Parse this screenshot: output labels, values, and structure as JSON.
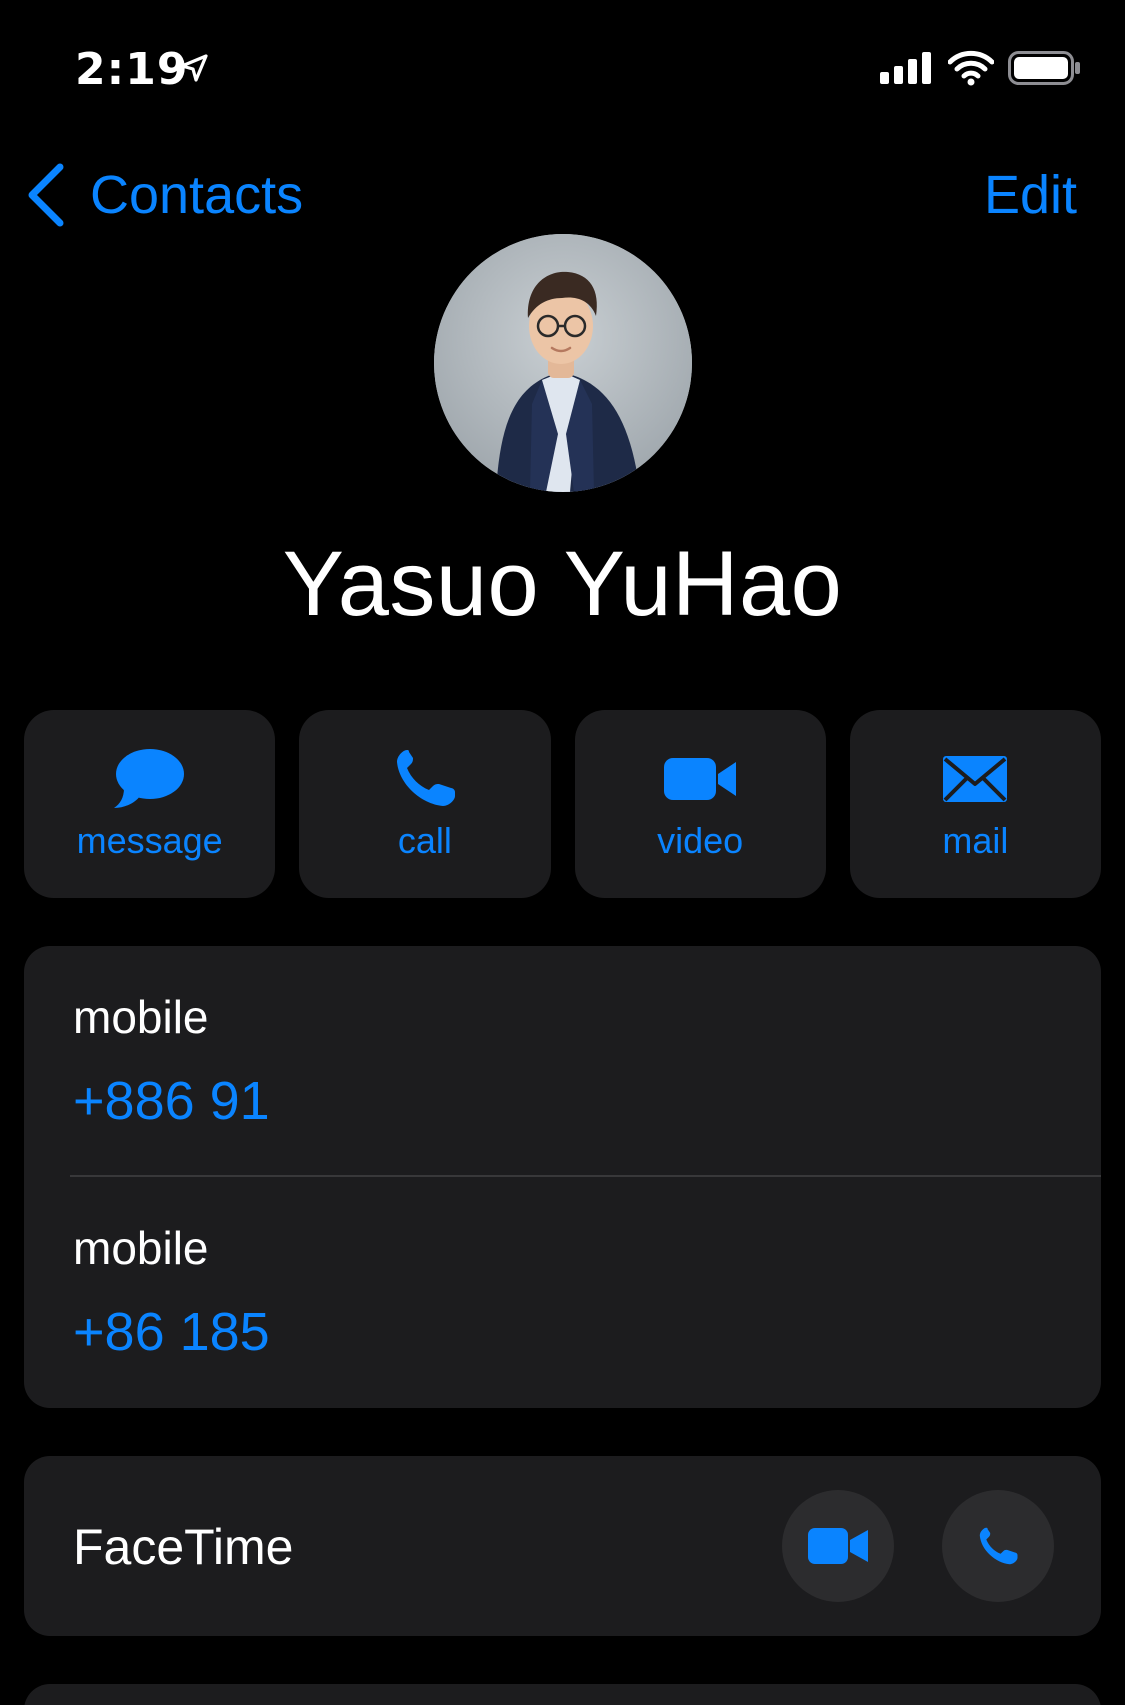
{
  "status_bar": {
    "time": "2:19",
    "icons": [
      "location-arrow-icon",
      "cellular-signal-icon",
      "wifi-icon",
      "battery-icon"
    ]
  },
  "nav": {
    "back_label": "Contacts",
    "edit_label": "Edit"
  },
  "contact": {
    "name": "Yasuo YuHao"
  },
  "actions": [
    {
      "label": "message",
      "icon": "message-bubble-icon"
    },
    {
      "label": "call",
      "icon": "phone-icon"
    },
    {
      "label": "video",
      "icon": "video-camera-icon"
    },
    {
      "label": "mail",
      "icon": "envelope-icon"
    }
  ],
  "phones": [
    {
      "label": "mobile",
      "number": "+886 91"
    },
    {
      "label": "mobile",
      "number": "+86 185"
    }
  ],
  "facetime": {
    "label": "FaceTime"
  },
  "colors": {
    "accent": "#0a84ff",
    "background": "#000000",
    "card": "#1c1c1e",
    "text": "#ffffff"
  }
}
